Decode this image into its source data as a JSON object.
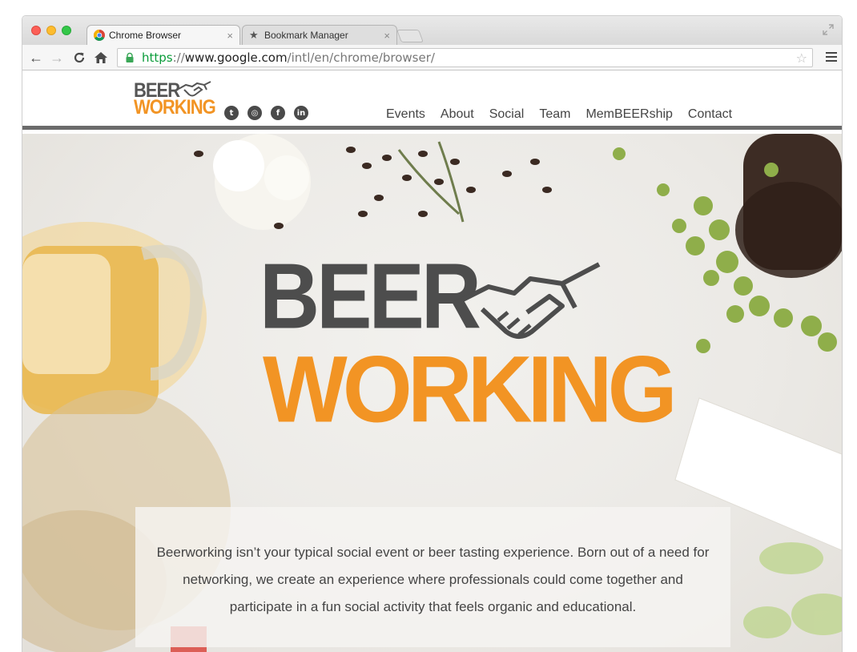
{
  "browser": {
    "tabs": [
      {
        "title": "Chrome Browser",
        "active": true,
        "icon": "chrome-icon"
      },
      {
        "title": "Bookmark Manager",
        "active": false,
        "icon": "star-icon"
      }
    ],
    "close_glyph": "×",
    "url": {
      "scheme": "https",
      "separator": "://",
      "host": "www.google.com",
      "path": "/intl/en/chrome/browser/"
    },
    "icons": {
      "back": "←",
      "forward": "→",
      "reload": "C",
      "home": "⌂",
      "star": "☆"
    }
  },
  "site": {
    "logo": {
      "line1": "BEER",
      "line2": "WORKING"
    },
    "social": [
      {
        "name": "twitter",
        "glyph": "t"
      },
      {
        "name": "instagram",
        "glyph": "◎"
      },
      {
        "name": "facebook",
        "glyph": "f"
      },
      {
        "name": "linkedin",
        "glyph": "in"
      }
    ],
    "nav": [
      "Events",
      "About",
      "Social",
      "Team",
      "MemBEERship",
      "Contact"
    ],
    "colors": {
      "orange": "#f29424",
      "gray": "#4d4d4d"
    }
  },
  "hero": {
    "logo": {
      "line1": "BEER",
      "line2": "WORKING"
    },
    "text": "Beerworking isn’t your typical social event or beer tasting experience. Born out of a need for networking, we create an experience where professionals could come together and participate in a fun social activity that feels organic and educational."
  }
}
